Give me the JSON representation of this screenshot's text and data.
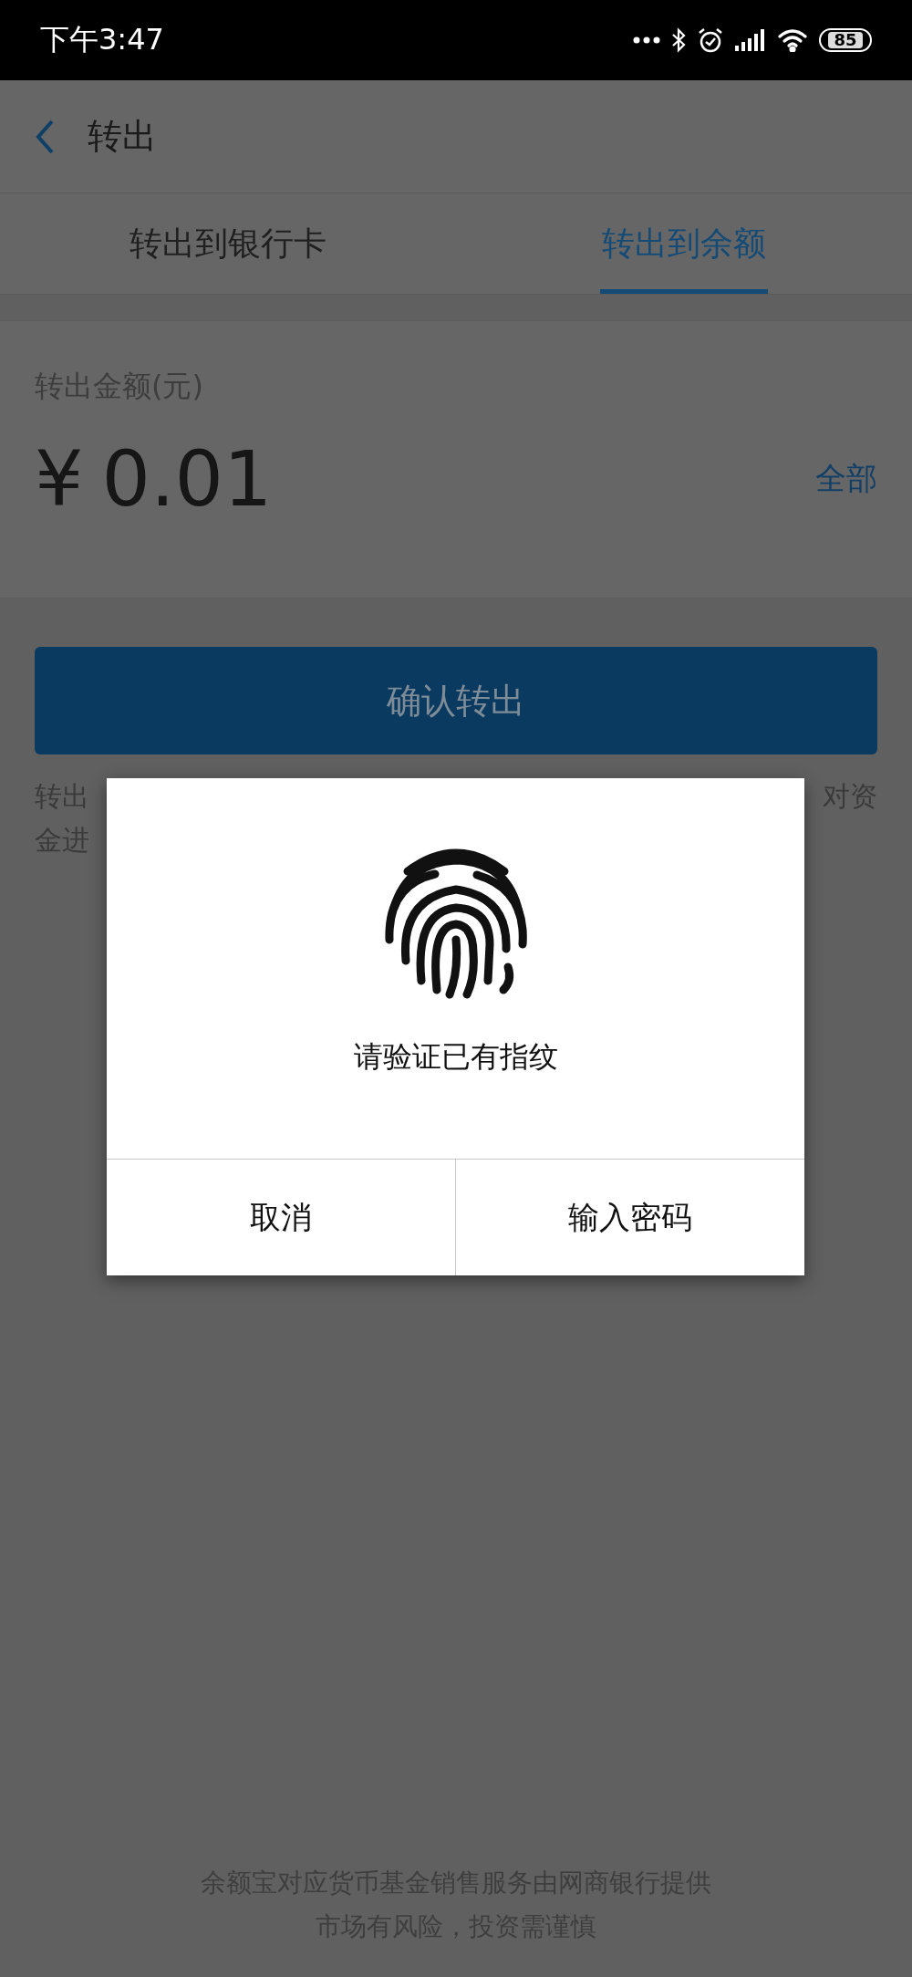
{
  "status_bar": {
    "time": "下午3:47",
    "battery": "85"
  },
  "header": {
    "title": "转出"
  },
  "tabs": [
    {
      "label": "转出到银行卡",
      "selected": false
    },
    {
      "label": "转出到余额",
      "selected": true
    }
  ],
  "amount": {
    "label": "转出金额(元)",
    "currency": "¥",
    "value": "0.01",
    "all_link": "全部"
  },
  "confirm_button": {
    "label": "确认转出"
  },
  "note_lines": [
    {
      "left": "转出",
      "right": "对资"
    },
    {
      "left": "金进"
    }
  ],
  "dialog": {
    "message": "请验证已有指纹",
    "buttons": [
      "取消",
      "输入密码"
    ]
  },
  "footer": [
    "余额宝对应货币基金销售服务由网商银行提供",
    "市场有风险，投资需谨慎"
  ]
}
